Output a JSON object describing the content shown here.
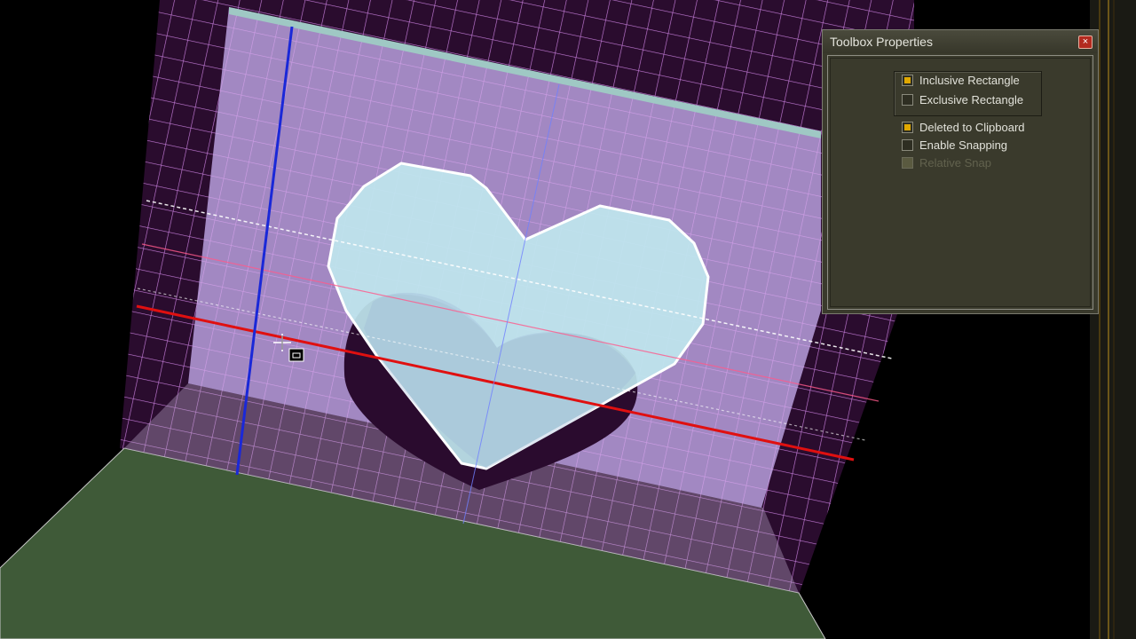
{
  "toolbox": {
    "title": "Toolbox Properties",
    "close_symbol": "×",
    "options": [
      {
        "label": "Inclusive Rectangle",
        "checked": true,
        "enabled": true
      },
      {
        "label": "Exclusive Rectangle",
        "checked": false,
        "enabled": true
      },
      {
        "label": "Deleted to Clipboard",
        "checked": true,
        "enabled": true
      },
      {
        "label": "Enable Snapping",
        "checked": false,
        "enabled": true
      },
      {
        "label": "Relative Snap",
        "checked": false,
        "enabled": false
      }
    ]
  },
  "viewport": {
    "cursor_icon": "crosshair-select-cursor-icon",
    "colors": {
      "background": "#000000",
      "grid_line": "#c27ad6",
      "grid_panel_fill": "#b79fdc",
      "heart_fill": "#bfe6ee",
      "floor": "#3f5a38",
      "x_axis": "#e01010",
      "y_axis": "#1a28d8",
      "checkbox_checked": "#e0a800"
    }
  }
}
